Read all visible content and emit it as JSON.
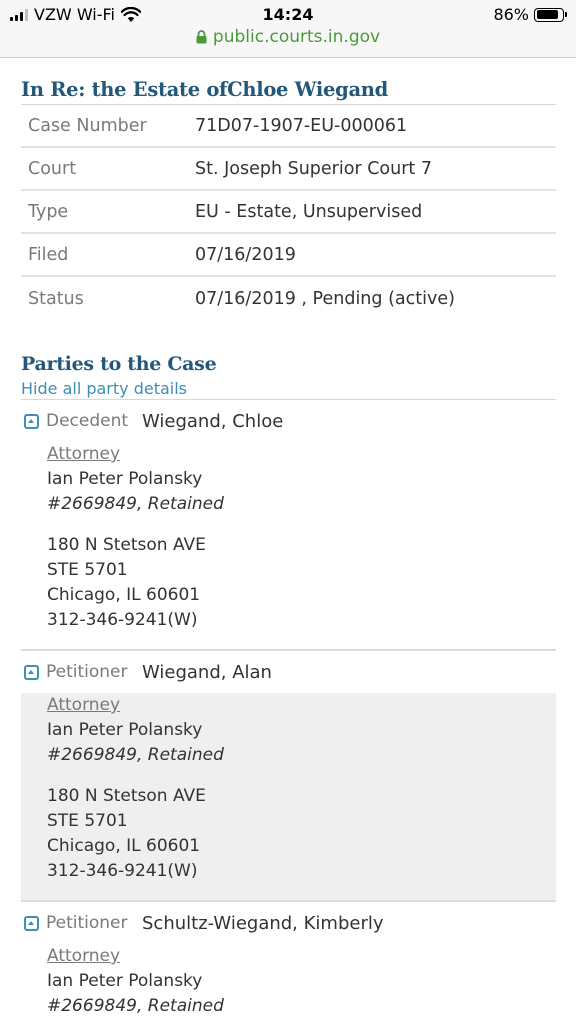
{
  "status_bar": {
    "carrier": "VZW Wi-Fi",
    "time": "14:24",
    "battery_percent": "86%",
    "battery_level": 0.86
  },
  "url": "public.courts.in.gov",
  "case": {
    "title": "In Re: the Estate ofChloe Wiegand",
    "rows": [
      {
        "label": "Case Number",
        "value": "71D07-1907-EU-000061"
      },
      {
        "label": "Court",
        "value": "St. Joseph Superior Court 7"
      },
      {
        "label": "Type",
        "value": "EU - Estate, Unsupervised"
      },
      {
        "label": "Filed",
        "value": "07/16/2019"
      },
      {
        "label": "Status",
        "value": "07/16/2019 , Pending  (active)"
      }
    ]
  },
  "parties": {
    "title": "Parties to the Case",
    "hide_link": "Hide all party details",
    "list": [
      {
        "role": "Decedent",
        "name": "Wiegand, Chloe",
        "attorney_label": "Attorney",
        "attorney_name": "Ian Peter Polansky",
        "attorney_id": "#2669849, Retained",
        "address1": "180 N Stetson AVE",
        "address2": "STE 5701",
        "city": "Chicago, IL 60601",
        "phone": "312-346-9241(W)"
      },
      {
        "role": "Petitioner",
        "name": "Wiegand, Alan",
        "attorney_label": "Attorney",
        "attorney_name": "Ian Peter Polansky",
        "attorney_id": "#2669849, Retained",
        "address1": "180 N Stetson AVE",
        "address2": "STE 5701",
        "city": "Chicago, IL 60601",
        "phone": "312-346-9241(W)"
      },
      {
        "role": "Petitioner",
        "name": "Schultz-Wiegand, Kimberly",
        "attorney_label": "Attorney",
        "attorney_name": "Ian Peter Polansky",
        "attorney_id": "#2669849, Retained"
      }
    ]
  },
  "colors": {
    "heading": "#23587a",
    "link": "#3d8fb5",
    "url_green": "#4a9a3b"
  }
}
